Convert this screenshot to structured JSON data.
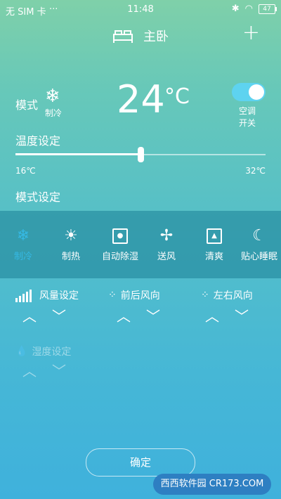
{
  "status": {
    "carrier": "无 SIM 卡",
    "time": "11:48",
    "battery": "47"
  },
  "header": {
    "title": "主卧",
    "add_label": "+"
  },
  "mode": {
    "label": "模式",
    "current": "制冷"
  },
  "temperature": {
    "value": "24",
    "unit": "°C",
    "min_label": "16℃",
    "max_label": "32℃",
    "min": 16,
    "max": 32,
    "current": 24
  },
  "power": {
    "label": "空调开关",
    "on": true
  },
  "sections": {
    "temp_setting": "温度设定",
    "mode_setting": "模式设定"
  },
  "modes": [
    {
      "label": "制冷",
      "icon": "snowflake-icon",
      "active": true
    },
    {
      "label": "制热",
      "icon": "sun-icon",
      "active": false
    },
    {
      "label": "自动除湿",
      "icon": "droplet-icon",
      "active": false
    },
    {
      "label": "送风",
      "icon": "fan-icon",
      "active": false
    },
    {
      "label": "清爽",
      "icon": "fresh-icon",
      "active": false
    },
    {
      "label": "贴心睡眠",
      "icon": "moon-icon",
      "active": false
    }
  ],
  "controls": {
    "fan_speed": "风量设定",
    "vertical_swing": "前后风向",
    "horizontal_swing": "左右风向",
    "humidity": "湿度设定"
  },
  "confirm": "确定",
  "watermark": "西西软件园 CR173.COM",
  "colors": {
    "accent": "#35b9e4",
    "toggle": "#5ed3f0"
  }
}
